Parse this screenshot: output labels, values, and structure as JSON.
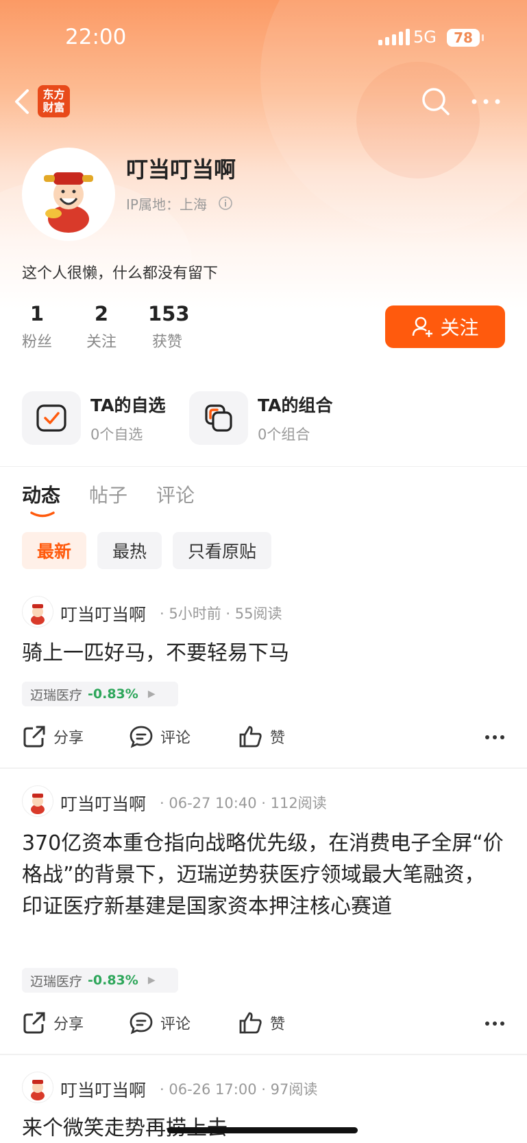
{
  "status_bar": {
    "time": "22:00",
    "network": "5G",
    "battery": "78"
  },
  "nav": {
    "logo_text_line1": "东方",
    "logo_text_line2": "财富"
  },
  "profile": {
    "name": "叮当叮当啊",
    "ip_location": "IP属地：上海",
    "bio": "这个人很懒，什么都没有留下",
    "stats": [
      {
        "value": "1",
        "label": "粉丝"
      },
      {
        "value": "2",
        "label": "关注"
      },
      {
        "value": "153",
        "label": "获赞"
      }
    ],
    "follow_label": "关注"
  },
  "quick_links": [
    {
      "title": "TA的自选",
      "sub": "0个自选",
      "icon": "checkbox-icon"
    },
    {
      "title": "TA的组合",
      "sub": "0个组合",
      "icon": "portfolio-icon"
    }
  ],
  "tabs": [
    {
      "label": "动态",
      "active": true
    },
    {
      "label": "帖子",
      "active": false
    },
    {
      "label": "评论",
      "active": false
    }
  ],
  "filters": [
    {
      "label": "最新",
      "active": true
    },
    {
      "label": "最热",
      "active": false
    },
    {
      "label": "只看原贴",
      "active": false
    }
  ],
  "action_labels": {
    "share": "分享",
    "comment": "评论",
    "like": "赞"
  },
  "posts": [
    {
      "author": "叮当叮当啊",
      "meta": "· 5小时前 · 55阅读",
      "title": "骑上一匹好马，不要轻易下马",
      "stock_name": "迈瑞医疗",
      "stock_change": "-0.83%"
    },
    {
      "author": "叮当叮当啊",
      "meta": "· 06-27 10:40 · 112阅读",
      "title": "370亿资本重仓指向战略优先级，在消费电子全屏“价格战”的背景下，迈瑞逆势获医疗领域最大笔融资，印证医疗新基建是国家资本押注核心赛道",
      "stock_name": "迈瑞医疗",
      "stock_change": "-0.83%"
    },
    {
      "author": "叮当叮当啊",
      "meta": "· 06-26 17:00 · 97阅读",
      "title": "来个微笑走势再捞上去"
    }
  ],
  "colors": {
    "accent": "#ff5a0d",
    "down_green": "#2da65a"
  }
}
